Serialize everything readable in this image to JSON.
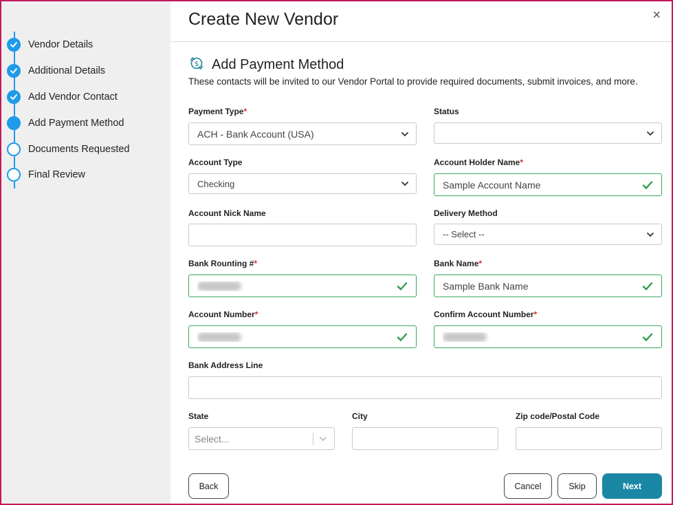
{
  "modal": {
    "title": "Create New Vendor",
    "close_glyph": "×"
  },
  "steps": [
    {
      "label": "Vendor Details",
      "state": "done"
    },
    {
      "label": "Additional Details",
      "state": "done"
    },
    {
      "label": "Add Vendor Contact",
      "state": "done"
    },
    {
      "label": "Add Payment Method",
      "state": "current"
    },
    {
      "label": "Documents Requested",
      "state": "pending"
    },
    {
      "label": "Final Review",
      "state": "pending"
    }
  ],
  "section": {
    "icon": "payment-method-icon",
    "title": "Add Payment Method",
    "description": "These contacts will be invited to our Vendor Portal to provide required documents, submit invoices, and more."
  },
  "fields": {
    "payment_type": {
      "label": "Payment Type",
      "value": "ACH - Bank Account (USA)"
    },
    "status": {
      "label": "Status",
      "value": ""
    },
    "account_type": {
      "label": "Account Type",
      "value": "Checking"
    },
    "account_holder_name": {
      "label": "Account Holder Name",
      "value": "Sample Account Name"
    },
    "account_nick_name": {
      "label": "Account Nick Name",
      "value": ""
    },
    "delivery_method": {
      "label": "Delivery Method",
      "value": "-- Select --"
    },
    "bank_routing": {
      "label": "Bank Rounting #",
      "value": ""
    },
    "bank_name": {
      "label": "Bank Name",
      "value": "Sample Bank Name"
    },
    "account_number": {
      "label": "Account Number",
      "value": ""
    },
    "confirm_account_number": {
      "label": "Confirm Account Number",
      "value": ""
    },
    "bank_address_line": {
      "label": "Bank Address Line",
      "value": ""
    },
    "state": {
      "label": "State",
      "placeholder": "Select..."
    },
    "city": {
      "label": "City",
      "value": ""
    },
    "zip": {
      "label": "Zip code/Postal Code",
      "value": ""
    }
  },
  "required_mark": "*",
  "buttons": {
    "back": "Back",
    "cancel": "Cancel",
    "skip": "Skip",
    "next": "Next"
  },
  "colors": {
    "accent": "#1e9be9",
    "valid_border": "#3aa85c",
    "primary_button": "#1a87a5",
    "required": "#d32f2f",
    "frame_border": "#c2185b"
  }
}
